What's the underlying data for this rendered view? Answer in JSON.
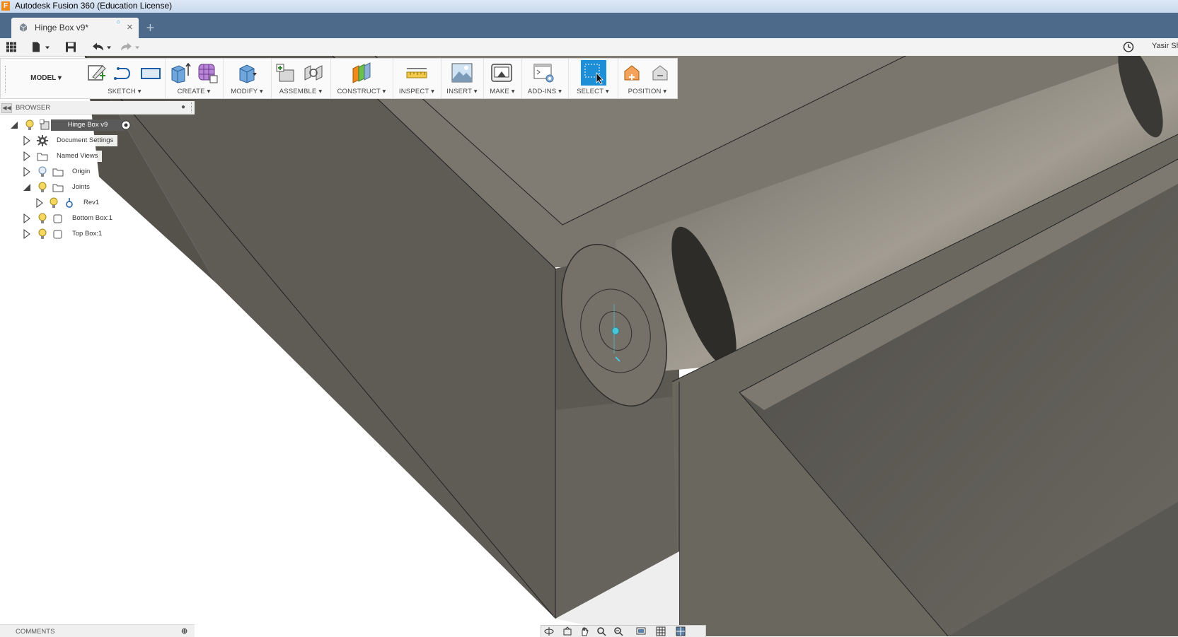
{
  "window": {
    "title": "Autodesk Fusion 360 (Education License)",
    "logo_letter": "F"
  },
  "tabs": [
    {
      "label": "Hinge Box v9*",
      "status_icon": "cloud-sync-icon",
      "close_glyph": "×"
    }
  ],
  "new_tab_glyph": "+",
  "quick_access": {
    "icons": [
      "apps-grid-icon",
      "file-icon",
      "save-icon",
      "undo-icon",
      "redo-icon"
    ],
    "job_status_icon": "clock-icon",
    "user_name": "Yasir Sh"
  },
  "toolbar": {
    "workspace": "MODEL ▾",
    "groups": [
      {
        "label": "SKETCH ▾",
        "icons": [
          "create-sketch-icon",
          "line-icon",
          "rectangle-icon"
        ]
      },
      {
        "label": "CREATE ▾",
        "icons": [
          "extrude-icon",
          "form-icon"
        ]
      },
      {
        "label": "MODIFY ▾",
        "icons": [
          "press-pull-icon"
        ]
      },
      {
        "label": "ASSEMBLE ▾",
        "icons": [
          "new-component-icon",
          "joint-icon"
        ]
      },
      {
        "label": "CONSTRUCT ▾",
        "icons": [
          "offset-plane-icon"
        ]
      },
      {
        "label": "INSPECT ▾",
        "icons": [
          "measure-icon"
        ]
      },
      {
        "label": "INSERT ▾",
        "icons": [
          "insert-image-icon"
        ]
      },
      {
        "label": "MAKE ▾",
        "icons": [
          "3d-print-icon"
        ]
      },
      {
        "label": "ADD-INS ▾",
        "icons": [
          "scripts-addins-icon"
        ]
      },
      {
        "label": "SELECT ▾",
        "icons": [
          "select-icon"
        ]
      },
      {
        "label": "POSITION ▾",
        "icons": [
          "capture-position-icon",
          "revert-position-icon"
        ]
      }
    ]
  },
  "browser": {
    "title": "BROWSER",
    "tree": [
      {
        "label": "Hinge Box v9",
        "expanded": true,
        "active": true
      },
      {
        "label": "Document Settings",
        "expanded": false
      },
      {
        "label": "Named Views",
        "expanded": false
      },
      {
        "label": "Origin",
        "expanded": false
      },
      {
        "label": "Joints",
        "expanded": true
      },
      {
        "label": "Rev1",
        "expanded": false
      },
      {
        "label": "Bottom Box:1",
        "expanded": false
      },
      {
        "label": "Top Box:1",
        "expanded": false
      }
    ]
  },
  "comments": {
    "title": "COMMENTS"
  },
  "navbar": {
    "icons": [
      "orbit-icon",
      "look-at-icon",
      "pan-icon",
      "zoom-icon",
      "fit-icon",
      "display-settings-icon",
      "grid-settings-icon",
      "viewports-icon"
    ]
  },
  "colors": {
    "accent_blue": "#1c8fd6",
    "tab_strip": "#4d6a8a",
    "model_gray": "#6f6c65",
    "selection_cyan": "#49c6d8"
  }
}
